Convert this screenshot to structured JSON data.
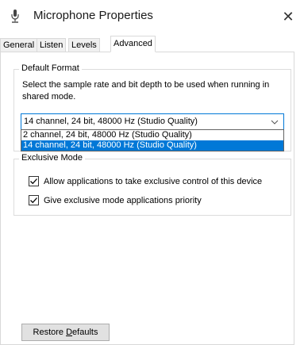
{
  "window": {
    "title": "Microphone Properties",
    "close_symbol": "✕",
    "icon": "microphone-icon"
  },
  "tabs": [
    {
      "label": "General",
      "active": false
    },
    {
      "label": "Listen",
      "active": false
    },
    {
      "label": "Levels",
      "active": false
    },
    {
      "label": "Advanced",
      "active": true
    }
  ],
  "default_format": {
    "group_label": "Default Format",
    "description": "Select the sample rate and bit depth to be used when running in shared mode.",
    "selected_value": "14 channel, 24 bit, 48000 Hz (Studio Quality)",
    "options": [
      {
        "label": "2 channel, 24 bit, 48000 Hz (Studio Quality)",
        "selected": false
      },
      {
        "label": "14 channel, 24 bit, 48000 Hz (Studio Quality)",
        "selected": true
      }
    ]
  },
  "exclusive_mode": {
    "group_label": "Exclusive Mode",
    "allow_label": "Allow applications to take exclusive control of this device",
    "allow_checked": true,
    "priority_label": "Give exclusive mode applications priority",
    "priority_checked": true
  },
  "buttons": {
    "restore_prefix": "Restore ",
    "restore_mnemonic": "D",
    "restore_suffix": "efaults"
  },
  "colors": {
    "accent": "#0078d7",
    "border": "#d9d9d9"
  }
}
